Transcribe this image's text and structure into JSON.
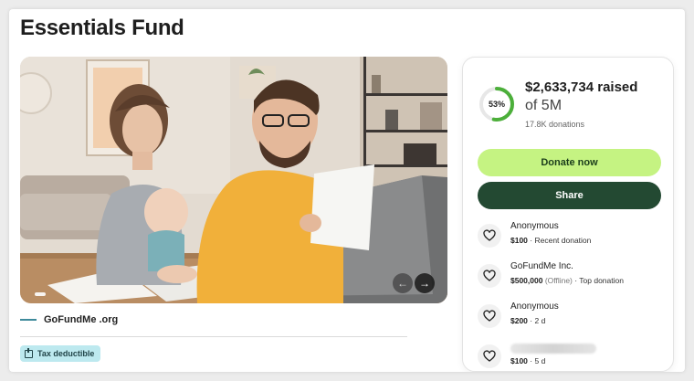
{
  "page": {
    "title": "Essentials Fund"
  },
  "hero": {
    "image_alt": "family-reviewing-bills-photo",
    "prev_label": "←",
    "next_label": "→"
  },
  "organizer": {
    "name": "GoFundMe .org"
  },
  "tax_badge": {
    "label": "Tax deductible"
  },
  "donation": {
    "percent": 53,
    "percent_label": "53%",
    "raised": "$2,633,734 raised",
    "goal": "of 5M",
    "count": "17.8K donations",
    "donate_label": "Donate now",
    "share_label": "Share",
    "colors": {
      "accent": "#c5f382",
      "share": "#234932",
      "ring": "#4caf3a"
    }
  },
  "donors": [
    {
      "name": "Anonymous",
      "amount": "$100",
      "detail": " · Recent donation",
      "offline": ""
    },
    {
      "name": "GoFundMe Inc.",
      "amount": "$500,000",
      "offline": " (Offline)",
      "detail": " · Top donation"
    },
    {
      "name": "Anonymous",
      "amount": "$200",
      "detail": " · 2 d",
      "offline": ""
    },
    {
      "name": "",
      "amount": "$100",
      "detail": " · 5 d",
      "offline": ""
    }
  ],
  "icons": {
    "donor": "heart-hand-icon",
    "tax": "receipt-icon"
  }
}
